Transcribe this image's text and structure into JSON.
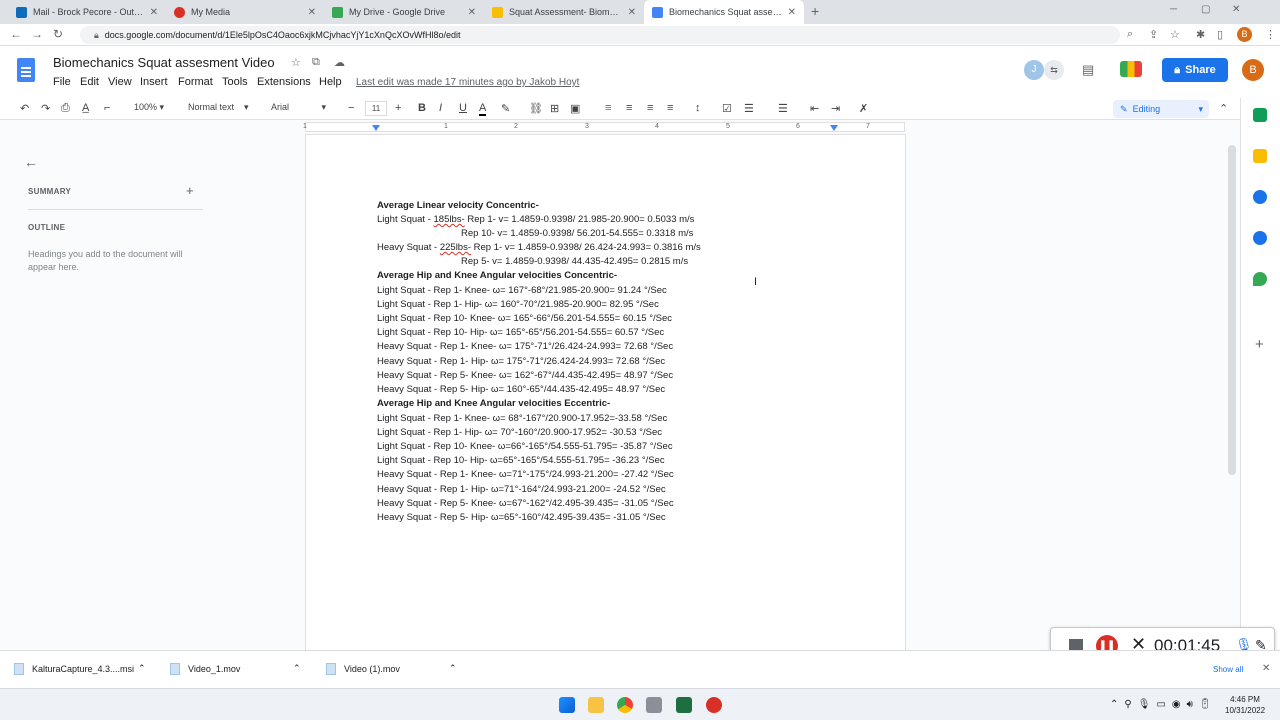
{
  "browser": {
    "tabs": [
      {
        "title": "Mail - Brock Pecore - Outlook",
        "color": "#0f6cbd"
      },
      {
        "title": "My Media",
        "color": "#d93025"
      },
      {
        "title": "My Drive - Google Drive",
        "color": "#34a853"
      },
      {
        "title": "Squat Assessment- Biomechanic",
        "color": "#fbbc04"
      },
      {
        "title": "Biomechanics Squat assesment",
        "color": "#4285f4"
      }
    ],
    "url": "docs.google.com/document/d/1Ele5lpOsC4Oaoc6xjkMCjvhacYjY1cXnQcXOvWfHl8o/edit",
    "profile_initial": "B"
  },
  "doc": {
    "title": "Biomechanics Squat assesment Video",
    "menus": [
      "File",
      "Edit",
      "View",
      "Insert",
      "Format",
      "Tools",
      "Extensions",
      "Help"
    ],
    "last_edit": "Last edit was made 17 minutes ago by Jakob Hoyt",
    "collaborator_initial": "J",
    "share_label": "Share",
    "profile_initial": "B"
  },
  "toolbar": {
    "zoom": "100%",
    "style": "Normal text",
    "font": "Arial",
    "font_size": "11",
    "mode": "Editing"
  },
  "ruler": {
    "numbers": [
      "1",
      "1",
      "2",
      "3",
      "4",
      "5",
      "6",
      "7"
    ]
  },
  "outline_panel": {
    "summary_label": "SUMMARY",
    "outline_label": "OUTLINE",
    "hint": "Headings you add to the document will appear here."
  },
  "content": {
    "h1": "Average Linear velocity Concentric-",
    "l1_pre": "Light Squat - ",
    "l1_mis": "185lbs-",
    "l1_post": " Rep 1- v= 1.4859-0.9398/ 21.985-20.900= 0.5033 m/s",
    "l2": "Rep 10- v= 1.4859-0.9398/ 56.201-54.555= 0.3318 m/s",
    "l3_pre": "Heavy Squat - ",
    "l3_mis": "225lbs-",
    "l3_post": " Rep 1- v= 1.4859-0.9398/ 26.424-24.993= 0.3816 m/s",
    "l4": "Rep 5- v=  1.4859-0.9398/ 44.435-42.495= 0.2815 m/s",
    "h2": "Average Hip and Knee Angular velocities Concentric-",
    "concentric": [
      "Light Squat - Rep 1- Knee- ω= 167°-68°/21.985-20.900= 91.24 °/Sec",
      "Light Squat - Rep 1- Hip- ω= 160°-70°/21.985-20.900= 82.95 °/Sec",
      "Light Squat - Rep 10- Knee- ω= 165°-66°/56.201-54.555= 60.15 °/Sec",
      "Light Squat - Rep 10- Hip- ω= 165°-65°/56.201-54.555= 60.57 °/Sec",
      "Heavy Squat - Rep 1- Knee- ω= 175°-71°/26.424-24.993= 72.68 °/Sec",
      "Heavy Squat - Rep 1- Hip- ω= 175°-71°/26.424-24.993= 72.68 °/Sec",
      "Heavy Squat - Rep 5- Knee- ω= 162°-67°/44.435-42.495= 48.97 °/Sec",
      "Heavy Squat - Rep 5- Hip- ω= 160°-65°/44.435-42.495= 48.97 °/Sec"
    ],
    "h3": "Average Hip and Knee Angular velocities Eccentric-",
    "eccentric": [
      "Light Squat - Rep 1- Knee- ω= 68°-167°/20.900-17.952=-33.58 °/Sec",
      "Light Squat - Rep 1- Hip- ω= 70°-160°/20.900-17.952= -30.53 °/Sec",
      "Light Squat - Rep 10- Knee- ω=66°-165°/54.555-51.795= -35.87 °/Sec",
      "Light Squat - Rep 10- Hip- ω=65°-165°/54.555-51.795= -36.23 °/Sec",
      "Heavy Squat - Rep 1- Knee- ω=71°-175°/24.993-21.200= -27.42 °/Sec",
      "Heavy Squat - Rep 1- Hip- ω=71°-164°/24.993-21.200= -24.52 °/Sec",
      "Heavy Squat - Rep 5- Knee- ω=67°-162°/42.495-39.435= -31.05 °/Sec",
      "Heavy Squat - Rep 5- Hip- ω=65°-160°/42.495-39.435= -31.05 °/Sec"
    ]
  },
  "recorder": {
    "time": "00:01:45"
  },
  "downloads": {
    "items": [
      "KalturaCapture_4.3....msi",
      "Video_1.mov",
      "Video (1).mov"
    ],
    "show_all": "Show all"
  },
  "taskbar": {
    "time": "4:46 PM",
    "date": "10/31/2022"
  }
}
